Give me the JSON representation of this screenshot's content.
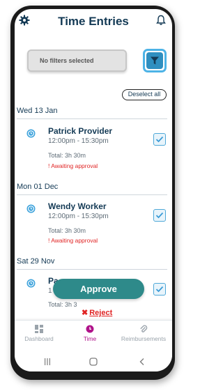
{
  "header": {
    "title": "Time Entries",
    "gear_icon": "gear-icon",
    "bell_icon": "bell-icon"
  },
  "filters": {
    "placeholder": "No filters selected",
    "filter_icon": "filter-icon"
  },
  "deselect_label": "Deselect all",
  "sections": [
    {
      "date": "Wed 13 Jan",
      "entry": {
        "name": "Patrick Provider",
        "time": "12:00pm - 15:30pm",
        "total": "Total: 3h 30m",
        "status": "! Awaiting approval",
        "checked": true
      }
    },
    {
      "date": "Mon 01 Dec",
      "entry": {
        "name": "Wendy Worker",
        "time": "12:00pm - 15:30pm",
        "total": "Total: 3h 30m",
        "status": "! Awaiting approval",
        "checked": true
      }
    },
    {
      "date": "Sat 29 Nov",
      "entry": {
        "name": "Pa",
        "time": "1",
        "total": "Total: 3h 3",
        "checked": true
      }
    }
  ],
  "actions": {
    "approve": "Approve",
    "reject": "Reject",
    "reject_icon": "✖"
  },
  "nav": [
    {
      "label": "Dashboard",
      "icon": "dashboard-icon",
      "active": false
    },
    {
      "label": "Time",
      "icon": "clock-icon",
      "active": true
    },
    {
      "label": "Reimbursements",
      "icon": "paperclip-icon",
      "active": false
    }
  ],
  "colors": {
    "title": "#143a55",
    "accent": "#2f8fc0",
    "approve": "#2e8a8a",
    "error": "#e02424",
    "active_nav": "#b0138a"
  }
}
